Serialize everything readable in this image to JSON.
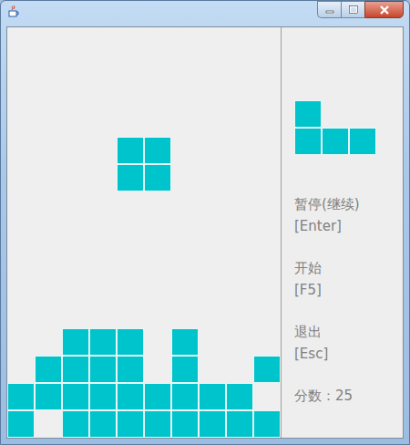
{
  "controls": [
    {
      "label": "暂停(继续)",
      "key": "[Enter]"
    },
    {
      "label": "开始",
      "key": "[F5]"
    },
    {
      "label": "退出",
      "key": "[Esc]"
    }
  ],
  "score": "分数：25",
  "board": {
    "cells": [
      [
        false,
        false,
        false,
        false,
        false,
        false,
        false,
        false,
        false,
        false
      ],
      [
        false,
        false,
        false,
        false,
        false,
        false,
        false,
        false,
        false,
        false
      ],
      [
        false,
        false,
        false,
        false,
        false,
        false,
        false,
        false,
        false,
        false
      ],
      [
        false,
        false,
        false,
        false,
        false,
        false,
        false,
        false,
        false,
        false
      ],
      [
        false,
        false,
        false,
        false,
        true,
        true,
        false,
        false,
        false,
        false
      ],
      [
        false,
        false,
        false,
        false,
        true,
        true,
        false,
        false,
        false,
        false
      ],
      [
        false,
        false,
        false,
        false,
        false,
        false,
        false,
        false,
        false,
        false
      ],
      [
        false,
        false,
        false,
        false,
        false,
        false,
        false,
        false,
        false,
        false
      ],
      [
        false,
        false,
        false,
        false,
        false,
        false,
        false,
        false,
        false,
        false
      ],
      [
        false,
        false,
        false,
        false,
        false,
        false,
        false,
        false,
        false,
        false
      ],
      [
        false,
        false,
        false,
        false,
        false,
        false,
        false,
        false,
        false,
        false
      ],
      [
        false,
        false,
        true,
        true,
        true,
        false,
        true,
        false,
        false,
        false
      ],
      [
        false,
        true,
        true,
        true,
        true,
        false,
        true,
        false,
        false,
        true
      ],
      [
        true,
        true,
        true,
        true,
        true,
        true,
        true,
        true,
        true,
        false
      ],
      [
        true,
        false,
        true,
        true,
        true,
        true,
        true,
        true,
        true,
        true
      ]
    ]
  },
  "next_piece": {
    "cells": [
      [
        true,
        false,
        false
      ],
      [
        true,
        true,
        true
      ]
    ]
  }
}
